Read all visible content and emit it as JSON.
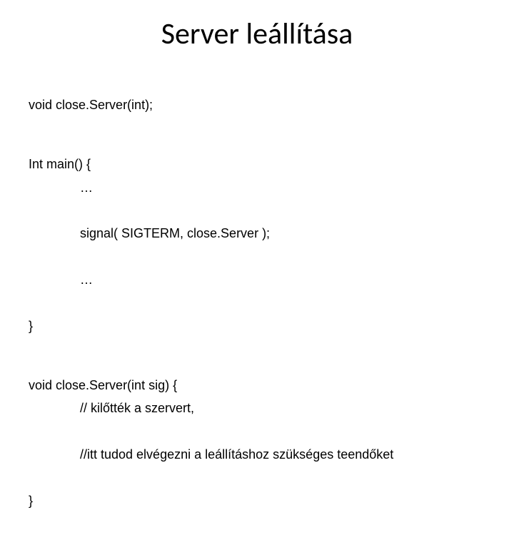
{
  "title": "Server leállítása",
  "lines": {
    "l1": "void close.Server(int);",
    "l2": "Int main() {",
    "l3": "…",
    "l4": "signal( SIGTERM, close.Server );",
    "l5": "…",
    "l6": "}",
    "l7": "void close.Server(int sig) {",
    "l8": "// kilőtték a szervert,",
    "l9": "//itt tudod elvégezni a leállításhoz szükséges teendőket",
    "l10": "}"
  }
}
